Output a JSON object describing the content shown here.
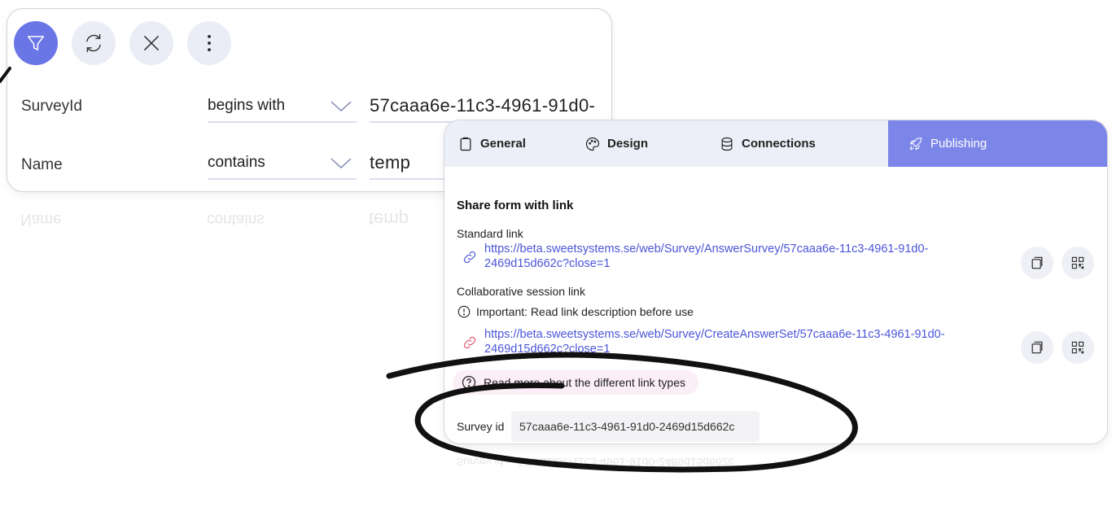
{
  "toolbar": {
    "filter_icon": "filter-icon",
    "refresh_icon": "refresh-icon",
    "close_icon": "close-icon",
    "more_icon": "more-vertical-icon",
    "accent": "#6a75e6"
  },
  "filters": [
    {
      "field": "SurveyId",
      "operator": "begins with",
      "value": "57caaa6e-11c3-4961-91d0-"
    },
    {
      "field": "Name",
      "operator": "contains",
      "value": "temp"
    }
  ],
  "tabs": {
    "general": "General",
    "design": "Design",
    "connections": "Connections",
    "publishing": "Publishing"
  },
  "publishing": {
    "title": "Share form with link",
    "standard_label": "Standard link",
    "standard_url_l1": "https://beta.sweetsystems.se/web/Survey/AnswerSurvey/57caaa6e-11c3-4961-91d0-",
    "standard_url_l2": "2469d15d662c?close=1",
    "collab_label": "Collaborative session link",
    "important_note": "Important: Read link description before use",
    "collab_url_l1": "https://beta.sweetsystems.se/web/Survey/CreateAnswerSet/57caaa6e-11c3-4961-91d0-",
    "collab_url_l2": "2469d15d662c?close=1",
    "read_more": "Read more about the different link types",
    "survey_id_label": "Survey id",
    "survey_id_value": "57caaa6e-11c3-4961-91d0-2469d15d662c"
  },
  "colors": {
    "link": "#4a55d8",
    "active_tab": "#7b86e8",
    "collab_link_icon": "#e0556a"
  }
}
